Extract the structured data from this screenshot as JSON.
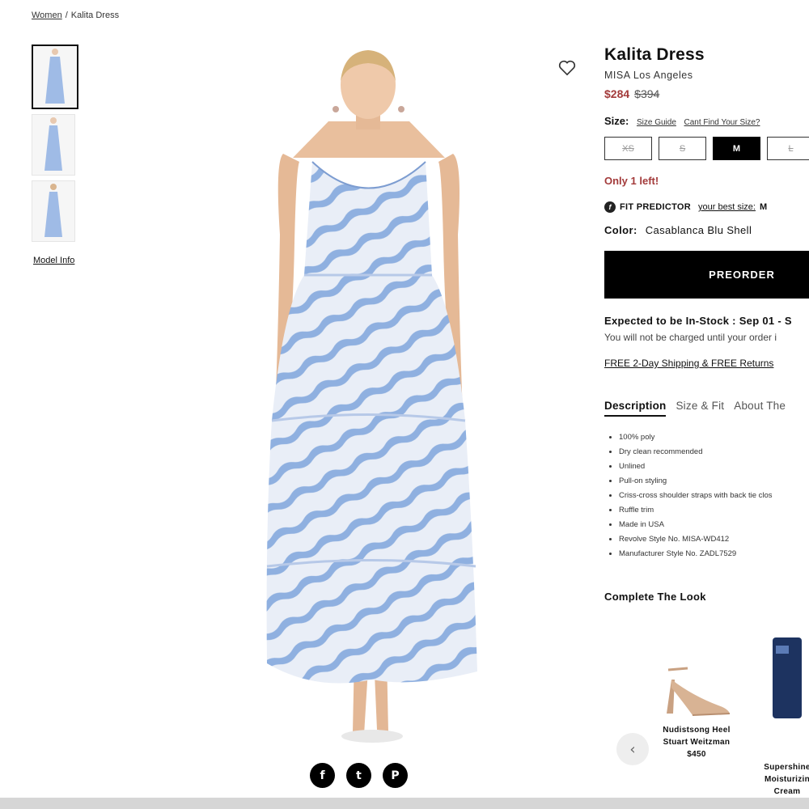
{
  "breadcrumb": {
    "parent": "Women",
    "separator": "/",
    "current": "Kalita Dress"
  },
  "thumbnails": {
    "count": 3,
    "model_info": "Model Info"
  },
  "social": [
    {
      "name": "facebook",
      "glyph": "f"
    },
    {
      "name": "twitter",
      "glyph": "t"
    },
    {
      "name": "pinterest",
      "glyph": "P"
    }
  ],
  "product": {
    "title": "Kalita Dress",
    "brand": "MISA Los Angeles",
    "sale_price": "$284",
    "original_price": "$394",
    "size_label": "Size:",
    "size_guide": "Size Guide",
    "cant_find": "Cant Find Your Size?",
    "sizes": [
      {
        "label": "XS",
        "available": false
      },
      {
        "label": "S",
        "available": false
      },
      {
        "label": "M",
        "available": true,
        "selected": true
      },
      {
        "label": "L",
        "available": false
      }
    ],
    "stock_message": "Only 1 left!",
    "fit_predictor": {
      "label": "FIT PREDICTOR",
      "best_size_label": "your best size:",
      "best_size": "M"
    },
    "color_label": "Color:",
    "color": "Casablanca Blu Shell",
    "cta": "PREORDER",
    "expected": "Expected to be In-Stock : Sep 01 - S",
    "charge_note": "You will not be charged until your order i",
    "shipping": "FREE 2-Day Shipping & FREE Returns",
    "tabs": [
      "Description",
      "Size & Fit",
      "About The"
    ],
    "details": [
      "100% poly",
      "Dry clean recommended",
      "Unlined",
      "Pull-on styling",
      "Criss-cross shoulder straps with back tie clos",
      "Ruffle trim",
      "Made in USA",
      "Revolve Style No. MISA-WD412",
      "Manufacturer Style No. ZADL7529"
    ]
  },
  "complete_the_look": {
    "heading": "Complete The Look",
    "items": [
      {
        "name": "Nudistsong Heel",
        "brand": "Stuart Weitzman",
        "price": "$450"
      },
      {
        "name": "Supershine",
        "brand": "Moisturizin",
        "extra": "Cream"
      }
    ]
  },
  "colors": {
    "accent_red": "#a33b3b",
    "dress_blue": "#8fb0e0",
    "black": "#000000"
  }
}
